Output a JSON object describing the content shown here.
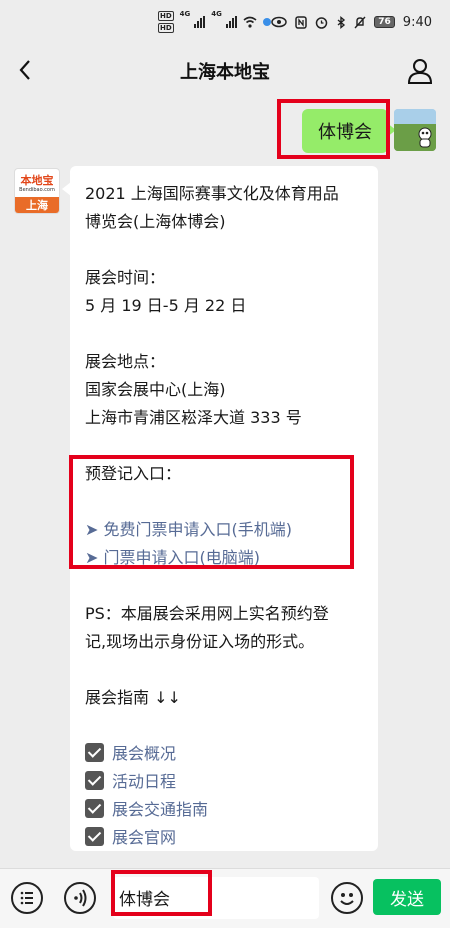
{
  "status_bar": {
    "hd1": "HD",
    "hd2": "HD",
    "net1": "4G",
    "net2": "4G",
    "battery": "76",
    "time": "9:40"
  },
  "header": {
    "title": "上海本地宝"
  },
  "messages": {
    "sent": {
      "text": "体博会"
    },
    "reply": {
      "avatar_logo": "本地宝",
      "avatar_url": "Bendibao.com",
      "avatar_city": "上海",
      "title_line1": "2021 上海国际赛事文化及体育用品",
      "title_line2": "博览会(上海体博会)",
      "time_label": "展会时间：",
      "time_value": "5 月 19 日-5 月 22 日",
      "place_label": "展会地点：",
      "place_line1": "国家会展中心(上海)",
      "place_line2": "上海市青浦区崧泽大道 333 号",
      "prereg_label": "预登记入口：",
      "link_mobile": "➤ 免费门票申请入口(手机端)",
      "link_pc": "➤ 门票申请入口(电脑端)",
      "ps_line1": "PS：本届展会采用网上实名预约登",
      "ps_line2": "记,现场出示身份证入场的形式。",
      "guide_label": "展会指南 ↓↓",
      "guide_items": [
        "展会概况",
        "活动日程",
        "展会交通指南",
        "展会官网"
      ]
    }
  },
  "input_bar": {
    "input_value": "体博会",
    "send_label": "发送"
  }
}
